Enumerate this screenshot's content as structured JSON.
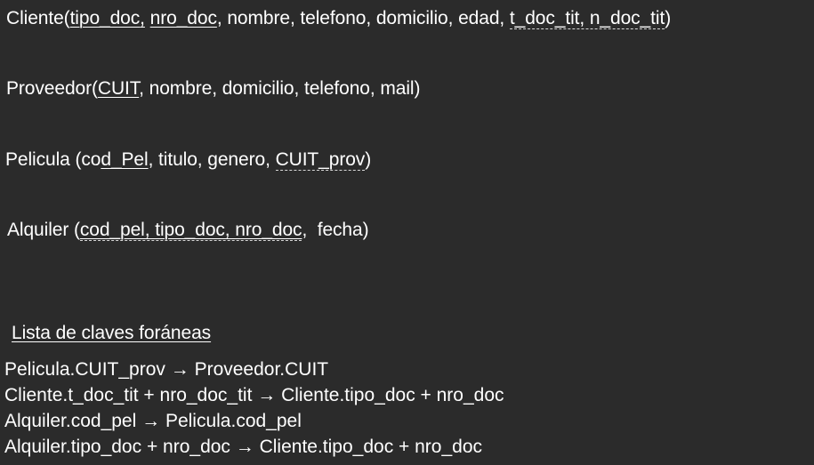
{
  "relations": {
    "cliente": {
      "name": "Cliente(",
      "pk1": "tipo_doc",
      "pk_sep": ",",
      "pk2": "nro_doc",
      "mid": ", nombre, telefono, domicilio, edad,",
      "fk": "t_doc_tit, n_doc_tit",
      "close": ")"
    },
    "proveedor": {
      "name": "Proveedor(",
      "pk": "CUIT",
      "rest": ", nombre, domicilio, telefono, mail)"
    },
    "pelicula": {
      "name": "Pelicula (co",
      "pk": "d_Pel",
      "mid": ", titulo, genero,",
      "fk": "CUIT_prov",
      "close": ")"
    },
    "alquiler": {
      "name": "Alquiler (",
      "pk": "cod_pel, tipo_doc, nro_doc",
      "comma": ",",
      "rest": "fecha)"
    }
  },
  "foreign_keys": {
    "heading": "Lista de claves foráneas",
    "items": [
      "Pelicula.CUIT_prov → Proveedor.CUIT",
      "Cliente.t_doc_tit + nro_doc_tit → Cliente.tipo_doc + nro_doc",
      "Alquiler.cod_pel → Pelicula.cod_pel",
      "Alquiler.tipo_doc + nro_doc → Cliente.tipo_doc + nro_doc"
    ]
  }
}
